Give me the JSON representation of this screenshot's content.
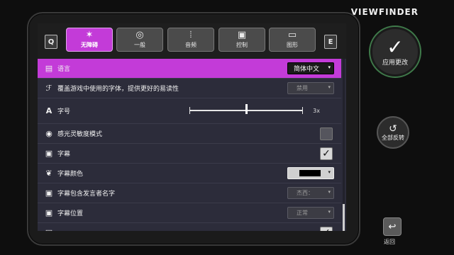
{
  "brand": "VIEWFINDER",
  "tabs": {
    "left_key": "Q",
    "right_key": "E",
    "items": [
      {
        "label": "无障碍",
        "icon": "accessibility-icon",
        "glyph": "✶",
        "active": true
      },
      {
        "label": "一般",
        "icon": "globe-icon",
        "glyph": "◎",
        "active": false
      },
      {
        "label": "音频",
        "icon": "sound-wave-icon",
        "glyph": "⦙",
        "active": false
      },
      {
        "label": "控制",
        "icon": "controller-icon",
        "glyph": "▣",
        "active": false
      },
      {
        "label": "图形",
        "icon": "monitor-icon",
        "glyph": "▭",
        "active": false
      }
    ]
  },
  "settings": {
    "language": {
      "label": "语言",
      "value": "简体中文",
      "icon": "language-icon"
    },
    "font_override": {
      "label": "覆盖游戏中使用的字体，提供更好的易读性",
      "value": "禁用",
      "icon": "font-icon"
    },
    "font_size": {
      "label": "字号",
      "value": "3x",
      "level": 0.5,
      "icon": "text-size-icon"
    },
    "photosensitive": {
      "label": "感光灵敏度模式",
      "checked": false,
      "icon": "eye-icon"
    },
    "subtitles": {
      "label": "字幕",
      "checked": true,
      "icon": "subtitles-icon"
    },
    "subtitle_color": {
      "label": "字幕颜色",
      "value": "#000000",
      "icon": "palette-icon"
    },
    "speaker_name": {
      "label": "字幕包含发言者名字",
      "value": "杰西：",
      "icon": "speaker-subtitle-icon"
    },
    "subtitle_position": {
      "label": "字幕位置",
      "value": "正常",
      "icon": "subtitle-position-icon"
    }
  },
  "actions": {
    "apply_label": "应用更改",
    "revert_label": "全部反转",
    "back_label": "返回"
  },
  "colors": {
    "accent": "#c33bd8",
    "panel": "#2c2c3a"
  }
}
